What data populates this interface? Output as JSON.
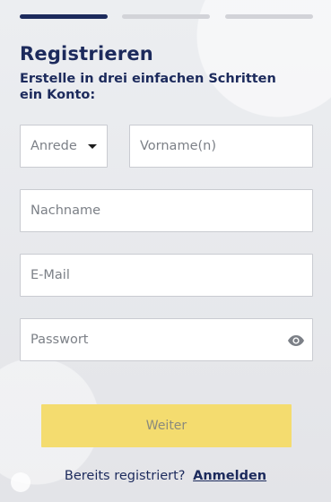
{
  "progress": {
    "current_step": 1,
    "total_steps": 3
  },
  "header": {
    "title": "Registrieren",
    "subtitle": "Erstelle in drei einfachen Schritten ein Konto:"
  },
  "form": {
    "salutation": {
      "placeholder": "Anrede",
      "icon": "caret-down-icon"
    },
    "first_name": {
      "placeholder": "Vorname(n)"
    },
    "last_name": {
      "placeholder": "Nachname"
    },
    "email": {
      "placeholder": "E-Mail"
    },
    "password": {
      "placeholder": "Passwort",
      "icon": "eye-icon"
    },
    "next_label": "Weiter"
  },
  "footer": {
    "already_registered": "Bereits registriert?",
    "login_link": "Anmelden"
  },
  "colors": {
    "primary": "#1c2a5c",
    "button_disabled": "#f4dc6f",
    "step_inactive": "#d2d3d8"
  }
}
